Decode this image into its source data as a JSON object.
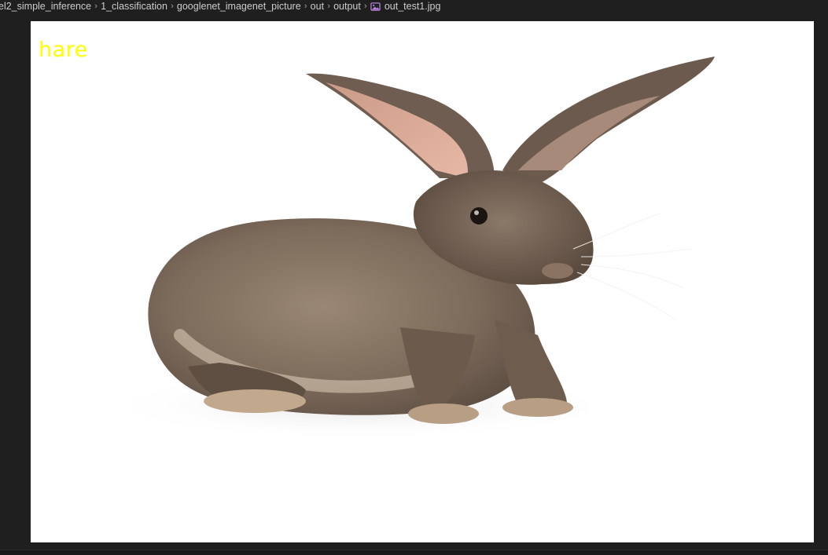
{
  "breadcrumb": {
    "items": [
      "el2_simple_inference",
      "1_classification",
      "googlenet_imagenet_picture",
      "out",
      "output",
      "out_test1.jpg"
    ],
    "separator": "›",
    "file_icon": "image-file-icon"
  },
  "image": {
    "label": "hare",
    "label_color": "#ffff00",
    "subject": "brown rabbit on white background"
  },
  "colors": {
    "editor_bg": "#1f1f1f",
    "image_bg": "#ffffff",
    "icon_purple": "#b180d7"
  }
}
